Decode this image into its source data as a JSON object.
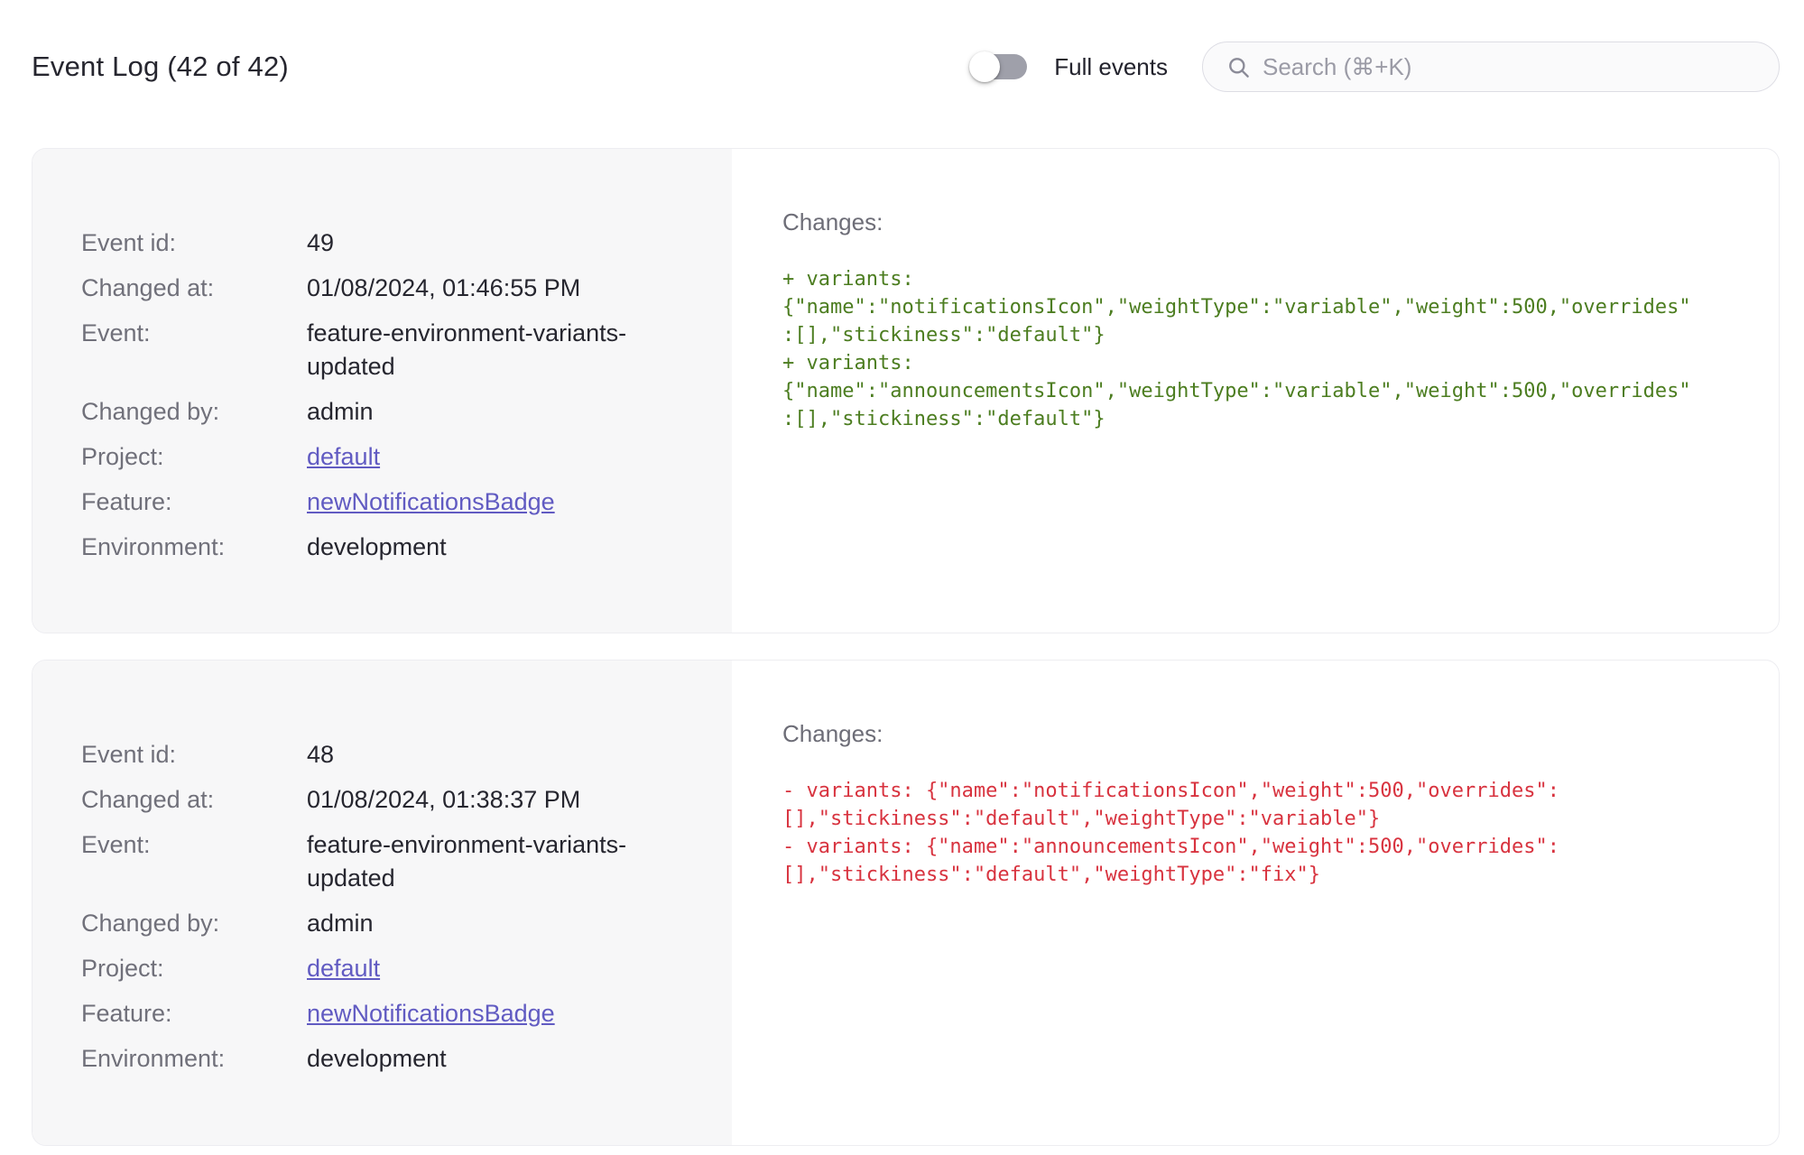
{
  "header": {
    "title": "Event Log (42 of 42)",
    "toggle_label": "Full events",
    "toggle_on": false,
    "search_placeholder": "Search (⌘+K)"
  },
  "colors": {
    "diff_added": "#4c7d20",
    "diff_removed": "#d8333f",
    "link": "#615bc2",
    "meta_panel_bg": "#f7f7f8"
  },
  "events": [
    {
      "rows": [
        {
          "label": "Event id:",
          "value": "49"
        },
        {
          "label": "Changed at:",
          "value": "01/08/2024, 01:46:55 PM"
        },
        {
          "label": "Event:",
          "value": "feature-environment-variants-updated"
        },
        {
          "label": "Changed by:",
          "value": "admin"
        },
        {
          "label": "Project:",
          "value": "default"
        },
        {
          "label": "Feature:",
          "value": "newNotificationsBadge"
        },
        {
          "label": "Environment:",
          "value": "development"
        }
      ],
      "changes_label": "Changes:",
      "diff_kind": "added",
      "diff_text": "+ variants:\n{\"name\":\"notificationsIcon\",\"weightType\":\"variable\",\"weight\":500,\"overrides\"\n:[],\"stickiness\":\"default\"}\n+ variants:\n{\"name\":\"announcementsIcon\",\"weightType\":\"variable\",\"weight\":500,\"overrides\"\n:[],\"stickiness\":\"default\"}"
    },
    {
      "rows": [
        {
          "label": "Event id:",
          "value": "48"
        },
        {
          "label": "Changed at:",
          "value": "01/08/2024, 01:38:37 PM"
        },
        {
          "label": "Event:",
          "value": "feature-environment-variants-updated"
        },
        {
          "label": "Changed by:",
          "value": "admin"
        },
        {
          "label": "Project:",
          "value": "default"
        },
        {
          "label": "Feature:",
          "value": "newNotificationsBadge"
        },
        {
          "label": "Environment:",
          "value": "development"
        }
      ],
      "changes_label": "Changes:",
      "diff_kind": "removed",
      "diff_text": "- variants: {\"name\":\"notificationsIcon\",\"weight\":500,\"overrides\":\n[],\"stickiness\":\"default\",\"weightType\":\"variable\"}\n- variants: {\"name\":\"announcementsIcon\",\"weight\":500,\"overrides\":\n[],\"stickiness\":\"default\",\"weightType\":\"fix\"}"
    }
  ]
}
